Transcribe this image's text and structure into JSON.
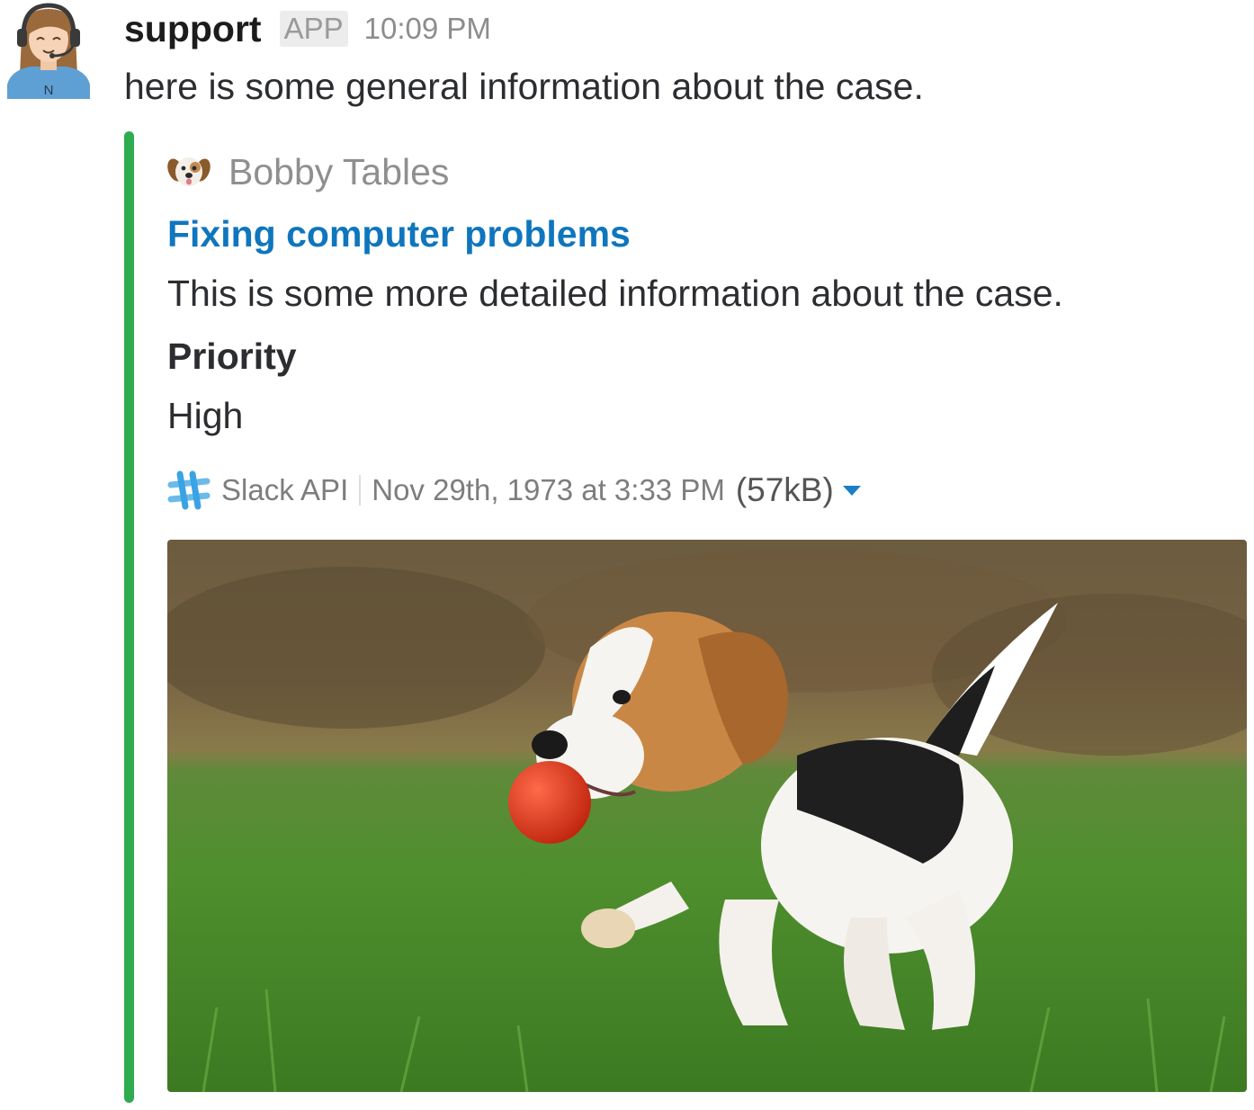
{
  "message": {
    "sender": "support",
    "badge": "APP",
    "time": "10:09 PM",
    "text": "here is some general information about the case.",
    "avatar_initial": "N"
  },
  "attachment": {
    "color": "#2fac4f",
    "author_name": "Bobby Tables",
    "title": "Fixing computer problems",
    "text": "This is some more detailed information about the case.",
    "fields": [
      {
        "title": "Priority",
        "value": "High"
      }
    ],
    "footer": "Slack API",
    "footer_ts": "Nov 29th, 1973 at 3:33 PM",
    "file_size": "(57kB)",
    "image_icon": "beagle-puppy-image"
  }
}
